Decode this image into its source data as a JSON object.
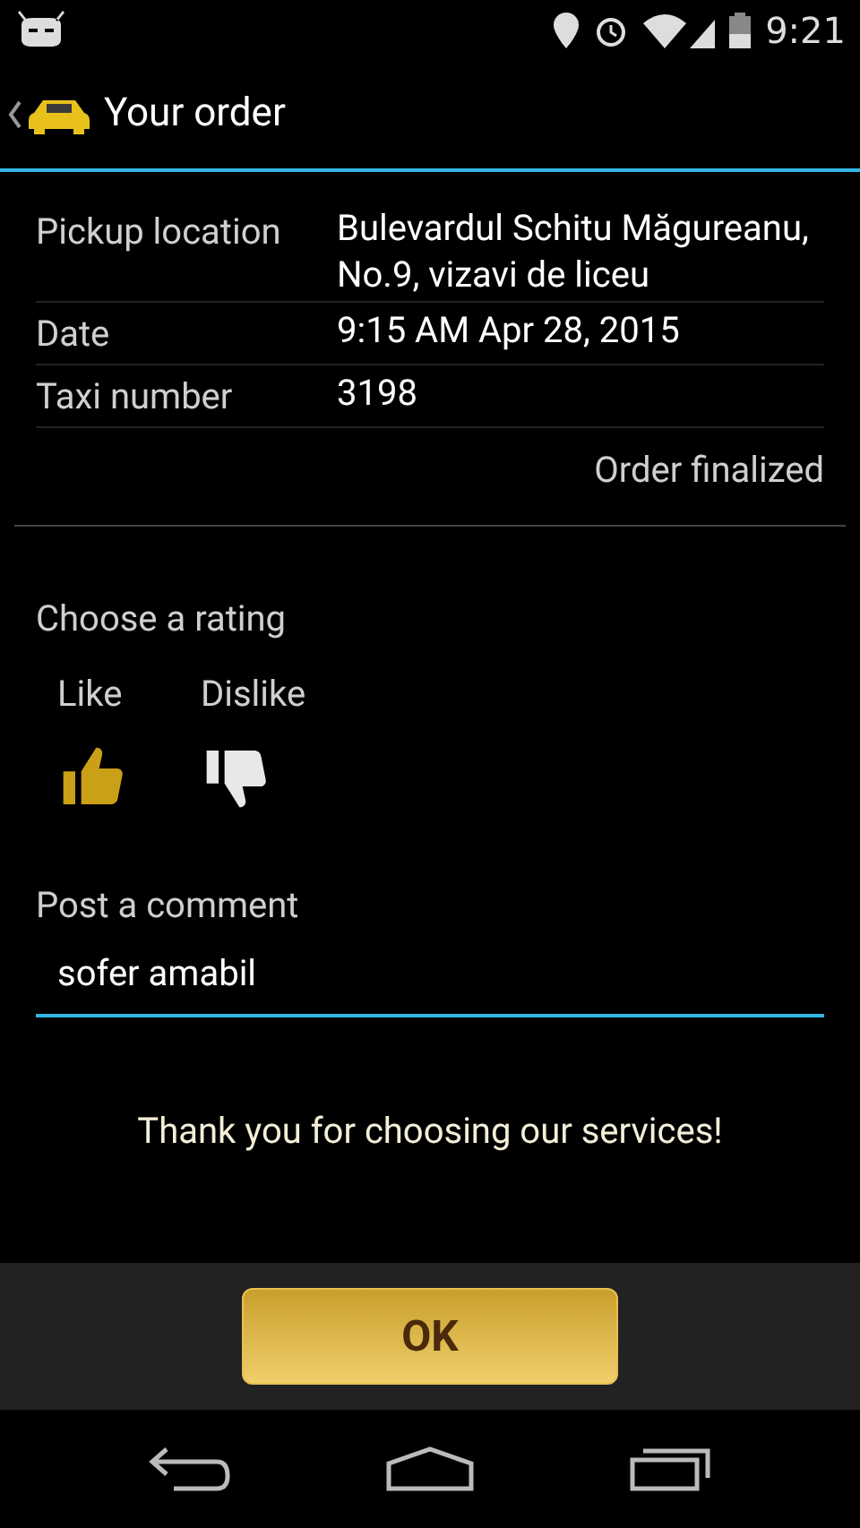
{
  "status_bar": {
    "time": "9:21"
  },
  "action_bar": {
    "title": "Your order"
  },
  "details": [
    {
      "label": "Pickup location",
      "value": "Bulevardul Schitu Măgureanu, No.9, vizavi de liceu"
    },
    {
      "label": "Date",
      "value": "9:15 AM Apr 28, 2015"
    },
    {
      "label": "Taxi number",
      "value": "3198"
    }
  ],
  "order_status": "Order finalized",
  "rating": {
    "heading": "Choose a rating",
    "options": [
      {
        "kind": "like",
        "label": "Like",
        "selected": true
      },
      {
        "kind": "dislike",
        "label": "Dislike",
        "selected": false
      }
    ]
  },
  "comment": {
    "heading": "Post a comment",
    "value": "sofer amabil"
  },
  "thanks": "Thank you for choosing our services!",
  "ok_button": "OK"
}
